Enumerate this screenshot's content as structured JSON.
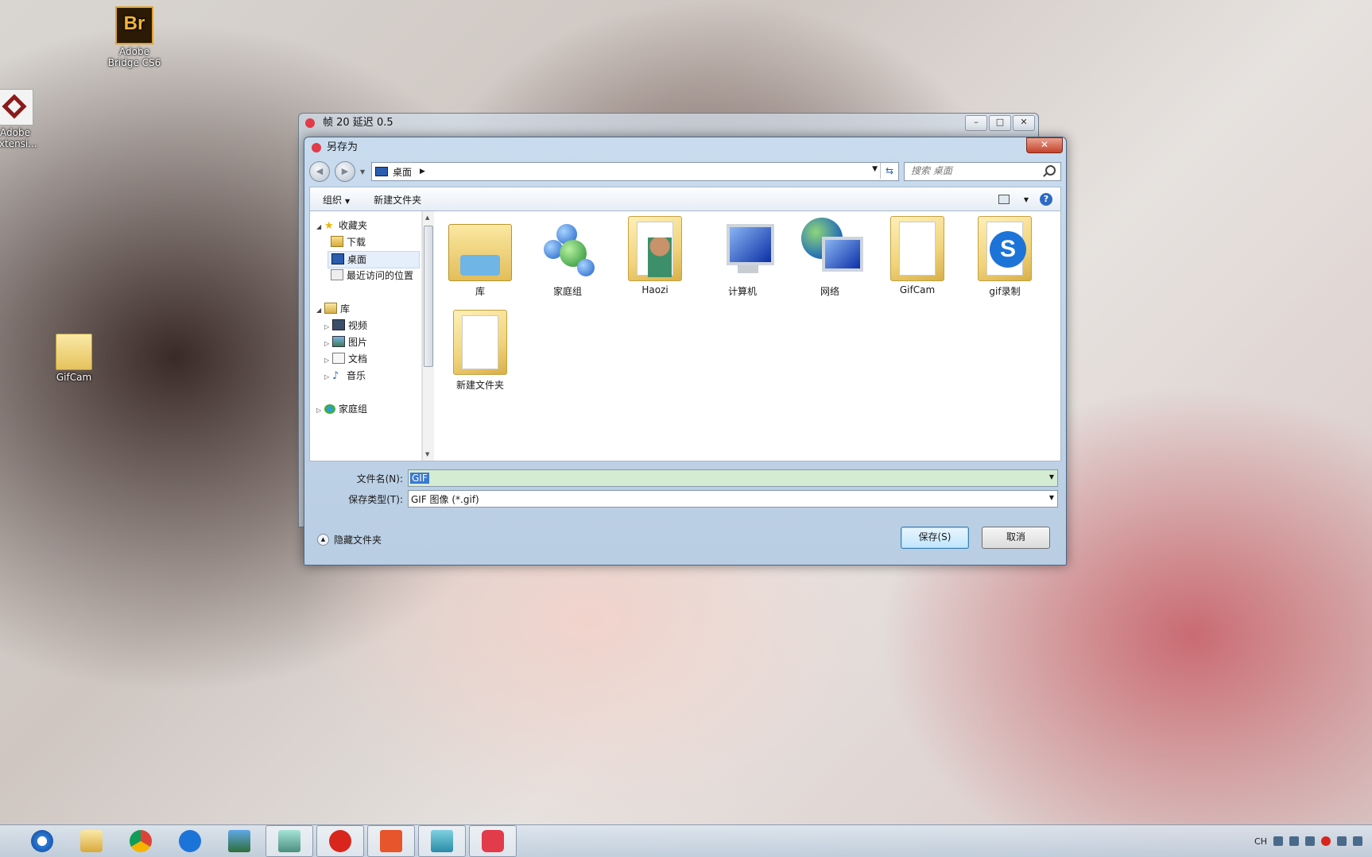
{
  "desktop": {
    "icons": [
      {
        "label_line1": "Adobe",
        "label_line2": "Bridge CS6",
        "glyph": "Br"
      },
      {
        "label_line1": "Adobe",
        "label_line2": "Extensi...",
        "glyph": ""
      },
      {
        "label_line1": "GifCam",
        "label_line2": "",
        "glyph": ""
      }
    ]
  },
  "back_window": {
    "title": "帧 20 延迟 0.5",
    "buttons": [
      "minimize",
      "maximize",
      "close"
    ]
  },
  "dialog": {
    "title": "另存为",
    "close_label": "✕",
    "address": {
      "crumb": "桌面",
      "back_icon": "back-arrow-icon",
      "forward_icon": "forward-arrow-icon"
    },
    "search": {
      "placeholder": "搜索 桌面"
    },
    "toolbar": {
      "organize": "组织",
      "new_folder": "新建文件夹",
      "help": "?"
    },
    "nav": {
      "favorites": "收藏夹",
      "downloads": "下载",
      "desktop": "桌面",
      "recent": "最近访问的位置",
      "libraries": "库",
      "videos": "视频",
      "pictures": "图片",
      "documents": "文档",
      "music": "音乐",
      "homegroup": "家庭组"
    },
    "files": [
      {
        "label": "库",
        "icon": "library-icon"
      },
      {
        "label": "家庭组",
        "icon": "homegroup-icon"
      },
      {
        "label": "Haozi",
        "icon": "user-folder-icon"
      },
      {
        "label": "计算机",
        "icon": "computer-icon"
      },
      {
        "label": "网络",
        "icon": "network-icon"
      },
      {
        "label": "GifCam",
        "icon": "folder-icon"
      },
      {
        "label": "gif录制",
        "icon": "sogou-folder-icon"
      },
      {
        "label": "新建文件夹",
        "icon": "folder-icon"
      }
    ],
    "filename_label": "文件名(N):",
    "filename_value": "GIF",
    "filetype_label": "保存类型(T):",
    "filetype_value": "GIF 图像 (*.gif)",
    "hide_folders": "隐藏文件夹",
    "save_button": "保存(S)",
    "cancel_button": "取消"
  },
  "taskbar": {
    "apps": [
      "internet-explorer",
      "file-explorer",
      "chrome",
      "sogou",
      "photo-viewer",
      "anime-app",
      "netease-music",
      "presentation",
      "pen-tool",
      "gif-camera"
    ],
    "tray_lang": "CH"
  }
}
